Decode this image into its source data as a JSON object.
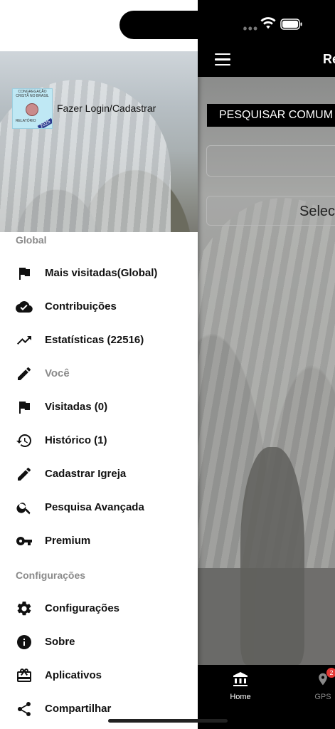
{
  "status_bar": {
    "signal": "••••"
  },
  "app": {
    "toolbar_title": "Re",
    "search_button": "PESQUISAR COMUM",
    "select_placeholder": "Selec",
    "bottom_nav": [
      {
        "label": "Home",
        "icon": "bank-icon"
      },
      {
        "label": "GPS",
        "icon": "map-pin-icon",
        "badge": "2"
      }
    ]
  },
  "drawer": {
    "logo": {
      "line1": "CONGREGAÇÃO CRISTÃ NO BRASIL",
      "line2": "RELATÓRIO",
      "year": "2025"
    },
    "login_label": "Fazer Login/Cadastrar",
    "sections": [
      {
        "title": "Global",
        "items": [
          {
            "label": "Mais visitadas(Global)",
            "icon": "flag-icon"
          },
          {
            "label": "Contribuições",
            "icon": "cloud-check-icon"
          },
          {
            "label": "Estatísticas (22516)",
            "icon": "trending-up-icon"
          },
          {
            "label": "Você",
            "icon": "pencil-icon",
            "disabled": true
          },
          {
            "label": "Visitadas (0)",
            "icon": "flag-icon"
          },
          {
            "label": "Histórico (1)",
            "icon": "history-icon"
          },
          {
            "label": "Cadastrar Igreja",
            "icon": "pencil-icon"
          },
          {
            "label": "Pesquisa Avançada",
            "icon": "search-icon"
          },
          {
            "label": "Premium",
            "icon": "key-icon"
          }
        ]
      },
      {
        "title": "Configurações",
        "items": [
          {
            "label": "Configurações",
            "icon": "gear-icon"
          },
          {
            "label": "Sobre",
            "icon": "info-icon"
          },
          {
            "label": "Aplicativos",
            "icon": "gift-card-icon"
          },
          {
            "label": "Compartilhar",
            "icon": "share-icon"
          }
        ]
      }
    ]
  }
}
